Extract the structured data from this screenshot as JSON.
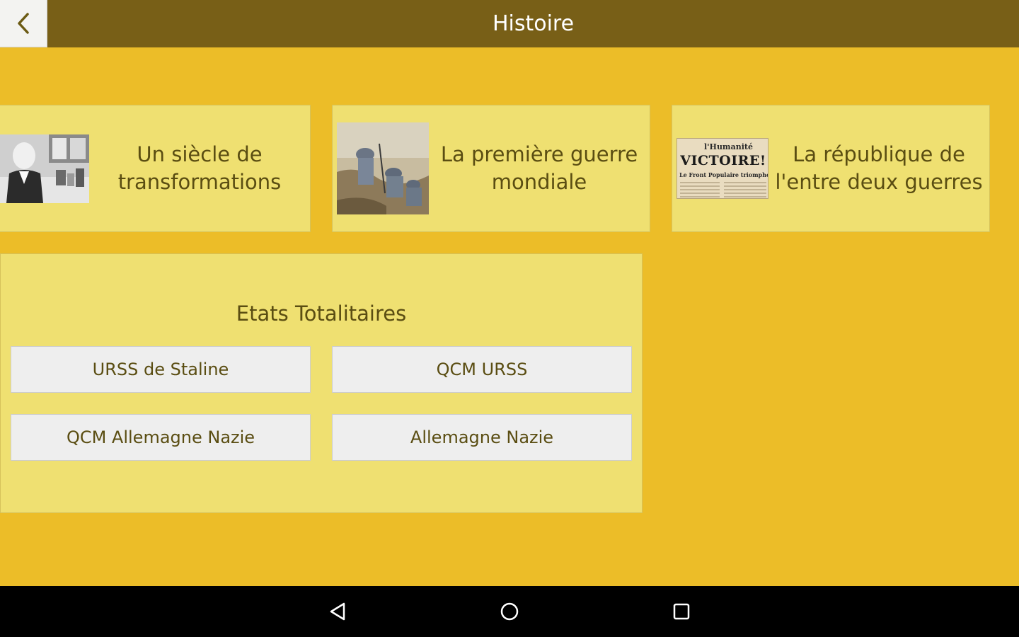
{
  "app": {
    "title": "Histoire",
    "colors": {
      "header": "#785f17",
      "background": "#ecbd28",
      "card": "#efe071",
      "button": "#eeeeee",
      "text": "#5a4d12"
    }
  },
  "header": {
    "back_icon": "chevron-left-icon"
  },
  "cards": [
    {
      "label_line1": "Un siècle de",
      "label_line2": "transformations",
      "image": "scientist-photo"
    },
    {
      "label_line1": "La première guerre",
      "label_line2": "mondiale",
      "image": "trench-soldiers-painting"
    },
    {
      "label_line1": "La république de",
      "label_line2": "l'entre deux guerres",
      "image": "newspaper-front-page",
      "newspaper": {
        "masthead": "l'Humanité",
        "headline": "VICTOIRE!",
        "subline": "Le Front Populaire triomphe"
      }
    }
  ],
  "panel": {
    "title": "Etats Totalitaires",
    "buttons": [
      {
        "label": "URSS de Staline"
      },
      {
        "label": "QCM URSS"
      },
      {
        "label": "QCM Allemagne Nazie"
      },
      {
        "label": "Allemagne Nazie"
      }
    ]
  },
  "navbar": {
    "back": "nav-back-icon",
    "home": "nav-home-icon",
    "recents": "nav-recents-icon"
  }
}
